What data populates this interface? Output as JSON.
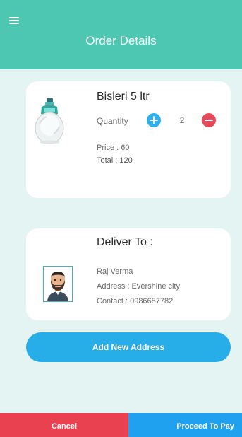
{
  "header": {
    "title": "Order Details",
    "menu_icon": "hamburger-menu-icon",
    "color": "#4ec7b2"
  },
  "product": {
    "name": "Bisleri 5 ltr",
    "image_icon": "water-bottle-icon",
    "quantity_label": "Quantity",
    "quantity": "2",
    "increment_icon": "plus-icon",
    "decrement_icon": "minus-icon",
    "price": "Price : 60",
    "total": "Total : 120"
  },
  "delivery": {
    "heading": "Deliver To :",
    "avatar_icon": "bearded-man-avatar-icon",
    "name": "Raj Verma",
    "address": "Address : Evershine city",
    "contact": "Contact : 0986687782"
  },
  "actions": {
    "add_address": "Add New Address",
    "cancel": "Cancel",
    "proceed": "Proceed To Pay"
  },
  "colors": {
    "background": "#e3f4f3",
    "accent_blue": "#27aee8",
    "cancel_red": "#ea4150",
    "proceed_blue": "#1fa1ef",
    "minus_red": "#e9475a"
  }
}
